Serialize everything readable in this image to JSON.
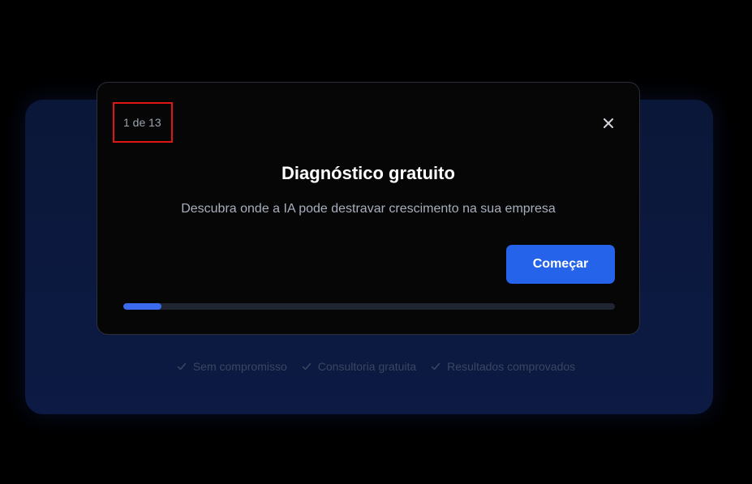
{
  "modal": {
    "step_counter": "1 de 13",
    "title": "Diagnóstico gratuito",
    "subtitle": "Descubra onde a IA pode destravar crescimento na sua empresa",
    "start_label": "Começar",
    "progress": {
      "current_step": 1,
      "total_steps": 13
    },
    "close_icon": "close-icon"
  },
  "background": {
    "features": [
      {
        "label": "Sem compromisso",
        "icon": "check-icon"
      },
      {
        "label": "Consultoria gratuita",
        "icon": "check-icon"
      },
      {
        "label": "Resultados comprovados",
        "icon": "check-icon"
      }
    ]
  },
  "colors": {
    "accent": "#2563eb",
    "modal_bg": "#060606",
    "highlight": "#e01515"
  }
}
